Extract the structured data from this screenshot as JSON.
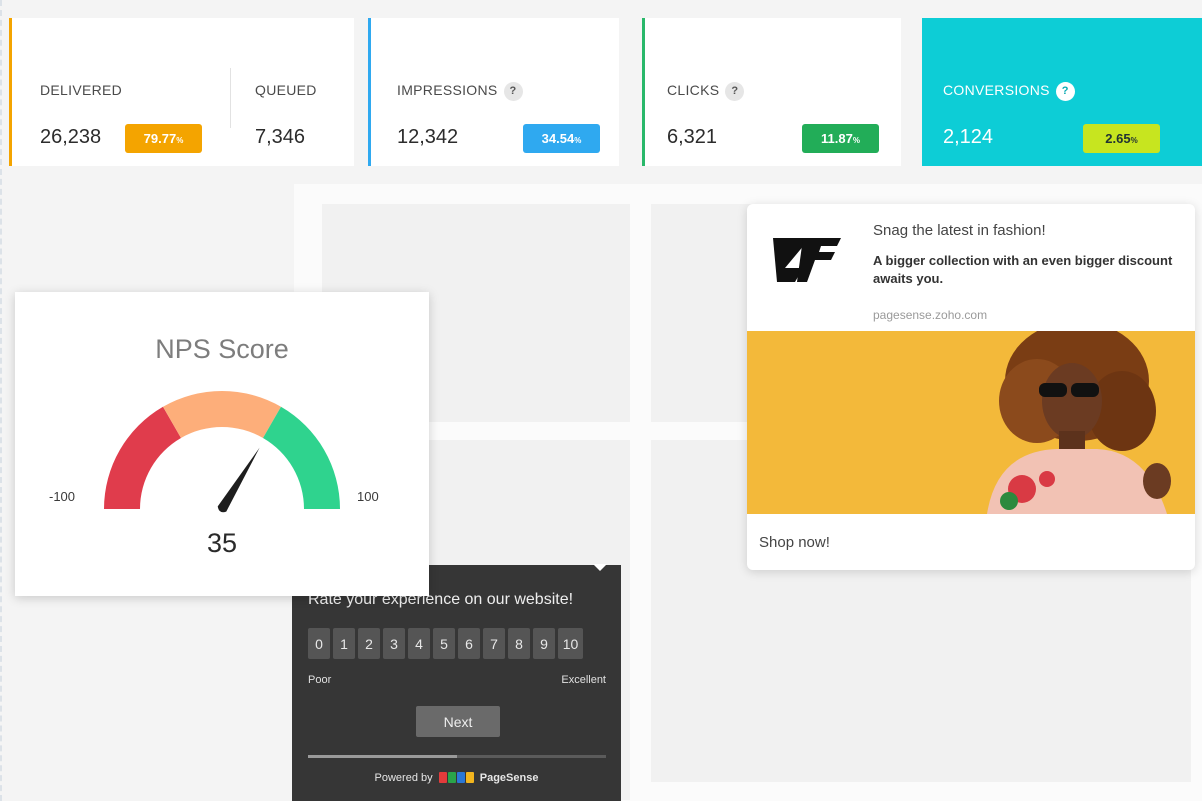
{
  "stats": {
    "delivered": {
      "label": "DELIVERED",
      "value": "26,238",
      "pct": "79.77",
      "pct_unit": "%",
      "color": "#f4a400"
    },
    "queued": {
      "label": "QUEUED",
      "value": "7,346"
    },
    "impressions": {
      "label": "IMPRESSIONS",
      "help": "?",
      "value": "12,342",
      "pct": "34.54",
      "pct_unit": "%",
      "color": "#2fa9f0"
    },
    "clicks": {
      "label": "CLICKS",
      "help": "?",
      "value": "6,321",
      "pct": "11.87",
      "pct_unit": "%",
      "color": "#22ad58"
    },
    "conversions": {
      "label": "CONVERSIONS",
      "help": "?",
      "value": "2,124",
      "pct": "2.65",
      "pct_unit": "%",
      "color": "#c7e51f"
    }
  },
  "nps": {
    "title": "NPS Score",
    "min_label": "-100",
    "max_label": "100",
    "value": "35",
    "segments": [
      "#e03c4c",
      "#fdae7a",
      "#2fd38e"
    ]
  },
  "ad": {
    "title": "Snag the latest in fashion!",
    "body": "A bigger collection with an even bigger discount awaits you.",
    "url": "pagesense.zoho.com",
    "cta": "Shop now!"
  },
  "rating": {
    "question": "Rate your experience on our website!",
    "scale": [
      "0",
      "1",
      "2",
      "3",
      "4",
      "5",
      "6",
      "7",
      "8",
      "9",
      "10"
    ],
    "low_label": "Poor",
    "high_label": "Excellent",
    "next_label": "Next",
    "progress": 0.5,
    "powered_prefix": "Powered by",
    "brand": "PageSense"
  }
}
